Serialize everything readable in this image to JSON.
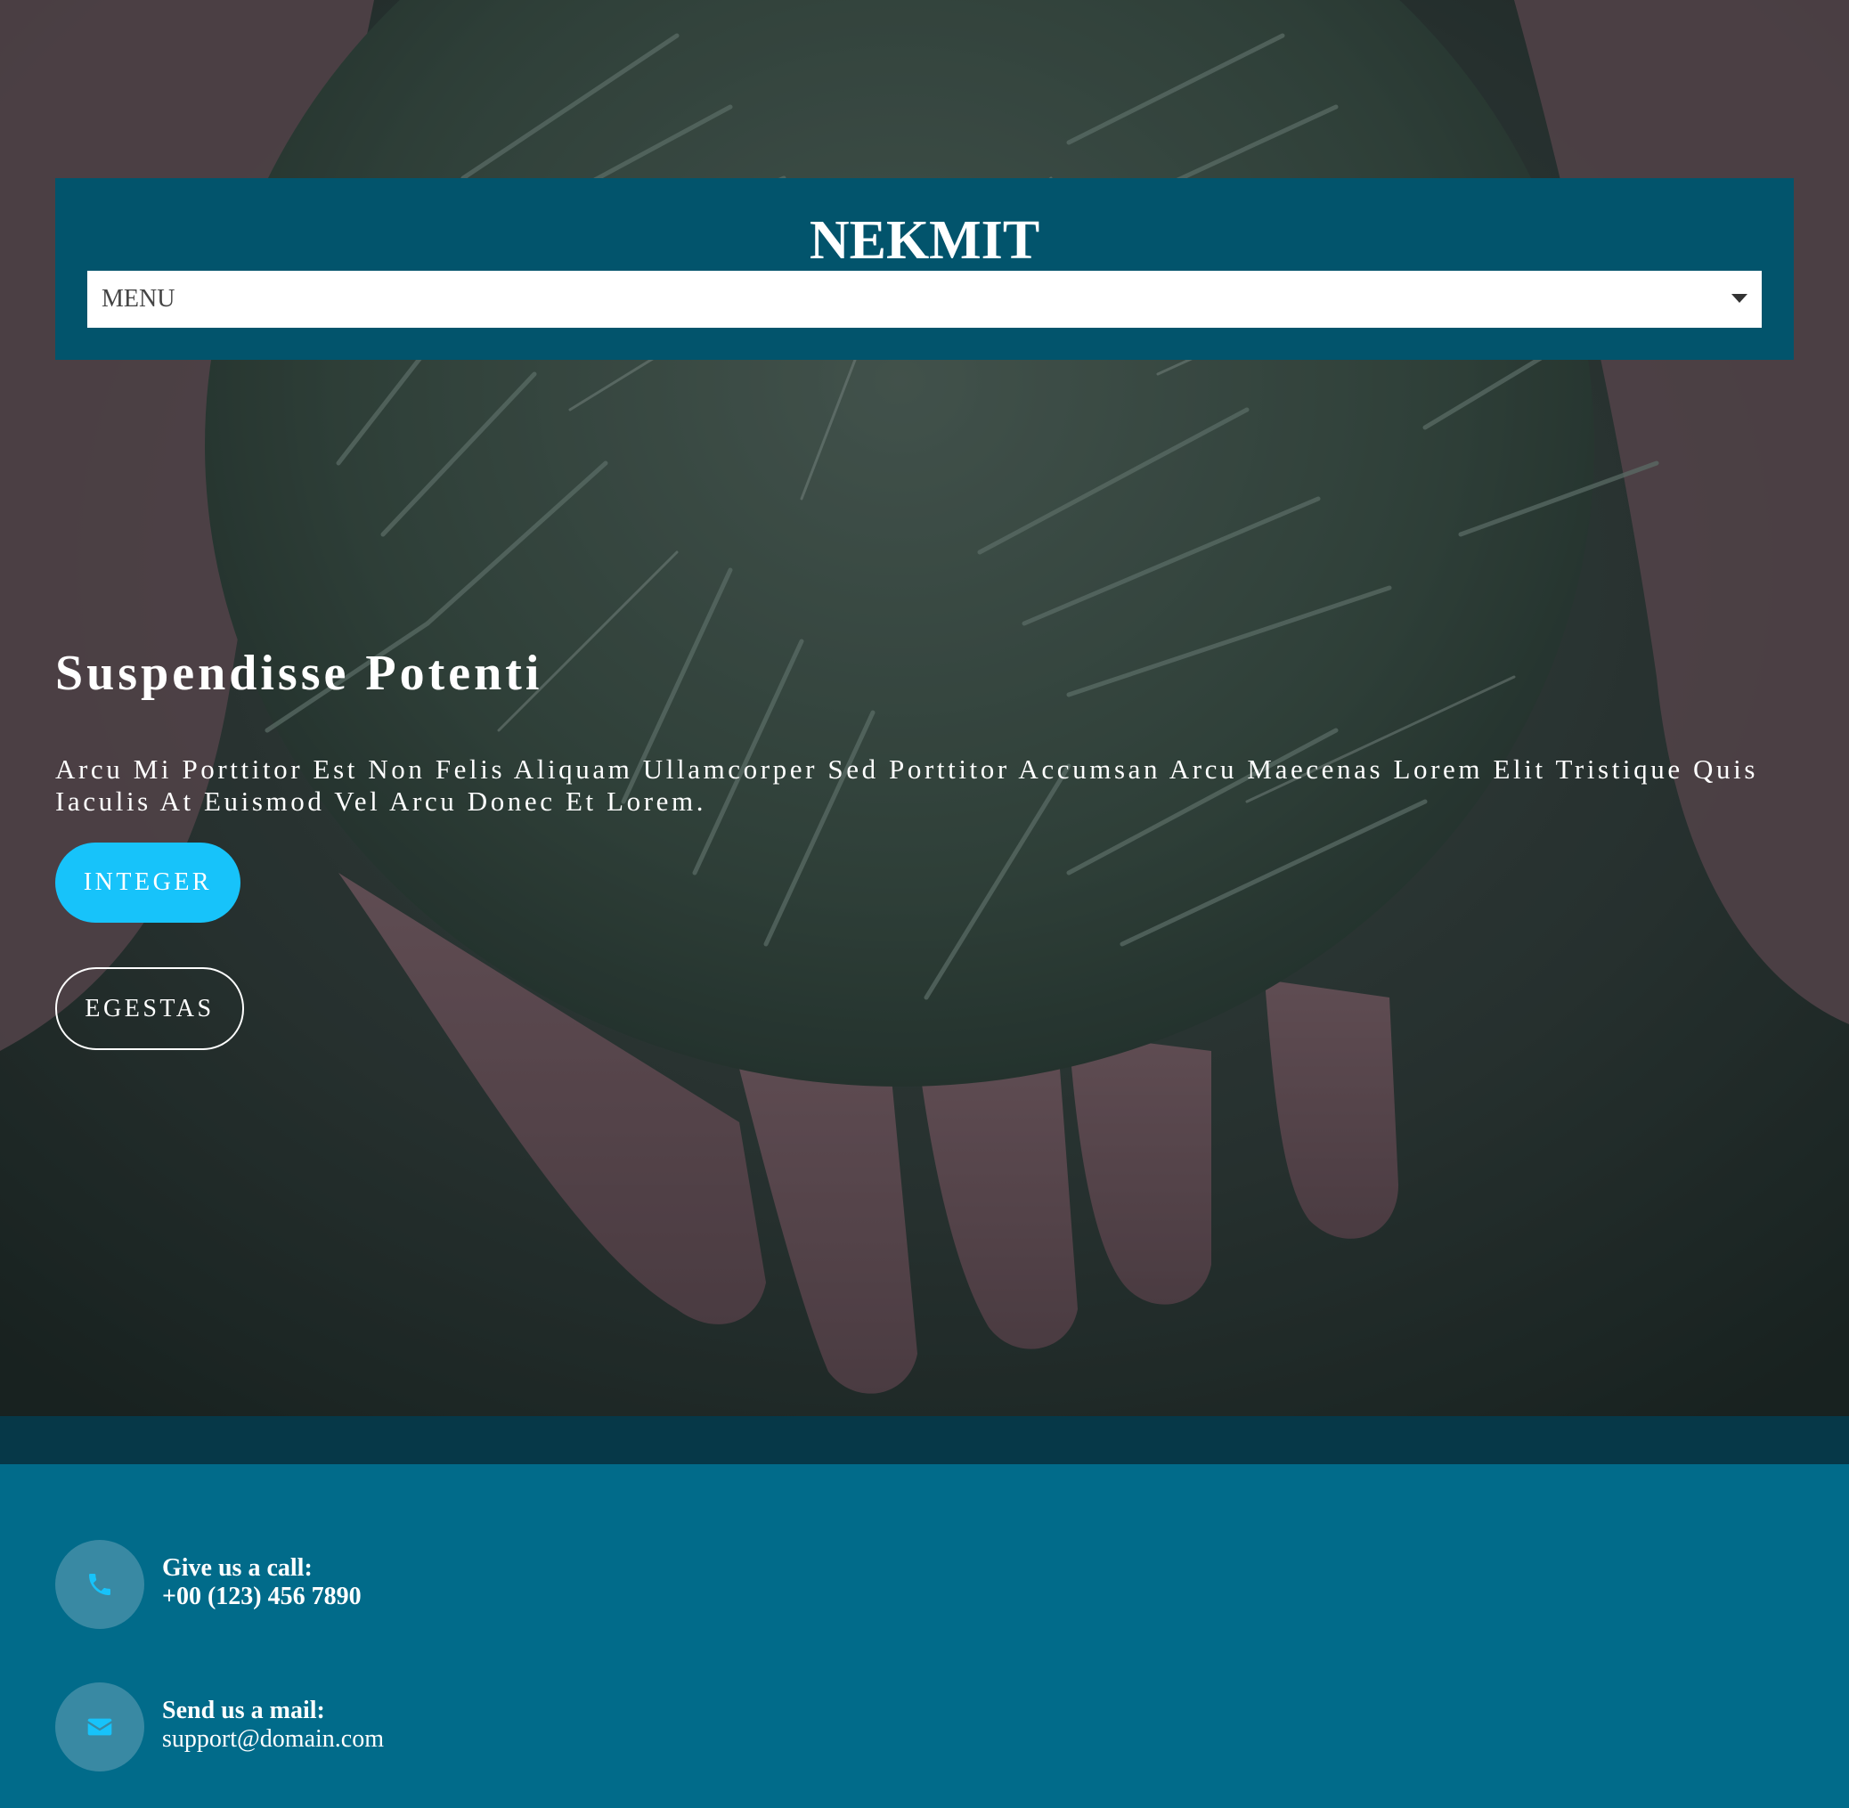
{
  "header": {
    "logo": "NEKMIT",
    "menu_label": "MENU"
  },
  "hero": {
    "title": "Suspendisse Potenti",
    "text": "Arcu Mi Porttitor Est Non Felis Aliquam Ullamcorper Sed Porttitor Accumsan Arcu Maecenas Lorem Elit Tristique Quis Iaculis At Euismod Vel Arcu Donec Et Lorem.",
    "primary_button": "INTEGER",
    "secondary_button": "EGESTAS"
  },
  "contact": {
    "call_label": "Give us a call:",
    "call_value": "+00 (123) 456 7890",
    "mail_label": "Send us a mail:",
    "mail_value": "support@domain.com"
  },
  "colors": {
    "header_bg": "#02546c",
    "accent": "#17c3fa",
    "contact_bg": "#016b8a",
    "band_bg": "#063848"
  },
  "icons": {
    "call": "phone-icon",
    "mail": "envelope-icon",
    "menu": "caret-down-icon"
  }
}
